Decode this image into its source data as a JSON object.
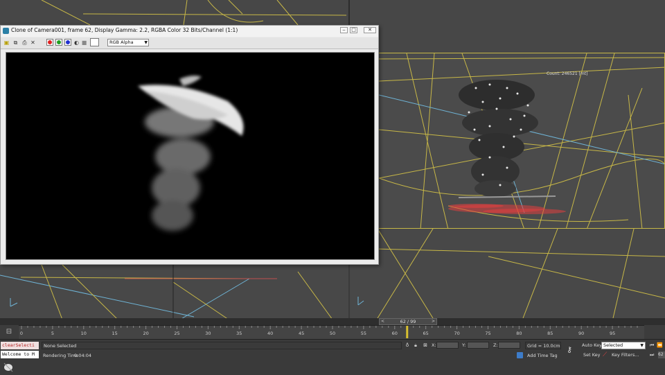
{
  "frame_window": {
    "title": "Clone of Camera001, frame 62, Display Gamma: 2.2, RGBA Color 32 Bits/Channel (1:1)",
    "channel": "RGB Alpha",
    "buttons": {
      "minimize": "‒",
      "restore": "□",
      "close": "✕"
    }
  },
  "viewport": {
    "count_label": "Count: 246521 [mt]"
  },
  "timeline": {
    "slider_label": "62 / 99",
    "prev": "<",
    "next": ">",
    "current_frame": 62,
    "total_frames": 99,
    "ticks": [
      "0",
      "5",
      "10",
      "15",
      "20",
      "25",
      "30",
      "35",
      "40",
      "45",
      "50",
      "55",
      "60",
      "65",
      "70",
      "75",
      "80",
      "85",
      "90",
      "95"
    ]
  },
  "status": {
    "maxscript_command": "clearSelecti",
    "maxscript_output": "Welcome to M",
    "selection": "None Selected",
    "render_time_label": "Rendering Time",
    "render_time_value": "0:04:04",
    "x_label": "X:",
    "y_label": "Y:",
    "z_label": "Z:",
    "grid": "Grid = 10.0cm",
    "add_time_tag": "Add Time Tag",
    "auto_key": "Auto Key",
    "set_key": "Set Key",
    "selected_option": "Selected",
    "key_filters": "Key Filters...",
    "frame_field": "62"
  },
  "icons": {
    "app": "3dsmax-icon",
    "save": "save-icon",
    "copy": "copy-icon",
    "print": "print-icon",
    "clear": "clear-icon",
    "key": "key-icon"
  },
  "colors": {
    "viewport_border": "#c8b847",
    "grid_lines": "#c8b847",
    "axis_lines": "#6fb4d6",
    "particles_red": "#e04040"
  }
}
